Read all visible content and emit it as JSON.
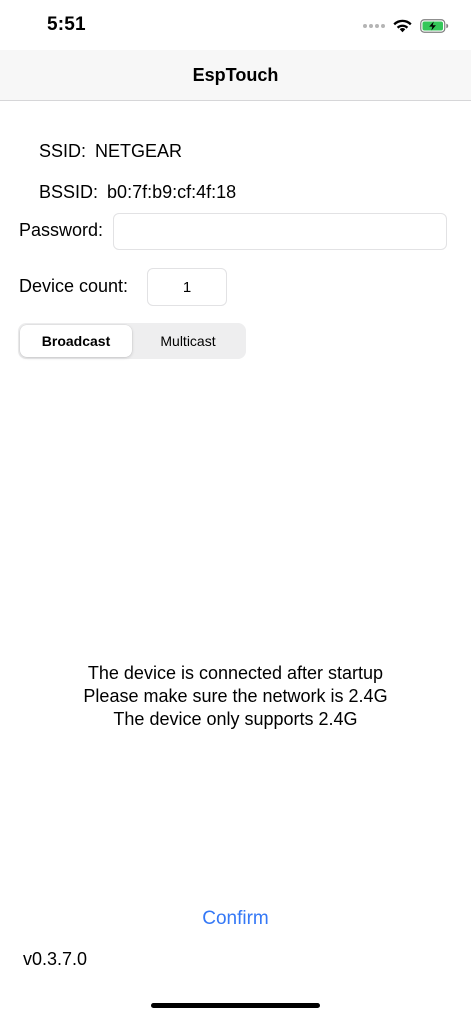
{
  "status_bar": {
    "time": "5:51",
    "icons": [
      "cellular-signal-icon",
      "wifi-icon",
      "battery-charging-icon"
    ],
    "battery_color": "#34c759"
  },
  "nav": {
    "title": "EspTouch"
  },
  "network": {
    "ssid_label": "SSID:",
    "ssid_value": "NETGEAR",
    "bssid_label": "BSSID:",
    "bssid_value": "b0:7f:b9:cf:4f:18"
  },
  "form": {
    "password_label": "Password:",
    "password_value": "",
    "device_count_label": "Device count:",
    "device_count_value": "1"
  },
  "mode": {
    "options": [
      "Broadcast",
      "Multicast"
    ],
    "selected": "Broadcast"
  },
  "info": {
    "lines": [
      "The device is connected after startup",
      "Please make sure the network is 2.4G",
      "The device only supports 2.4G"
    ]
  },
  "actions": {
    "confirm_label": "Confirm",
    "accent_color": "#3478f6"
  },
  "footer": {
    "version": "v0.3.7.0"
  }
}
